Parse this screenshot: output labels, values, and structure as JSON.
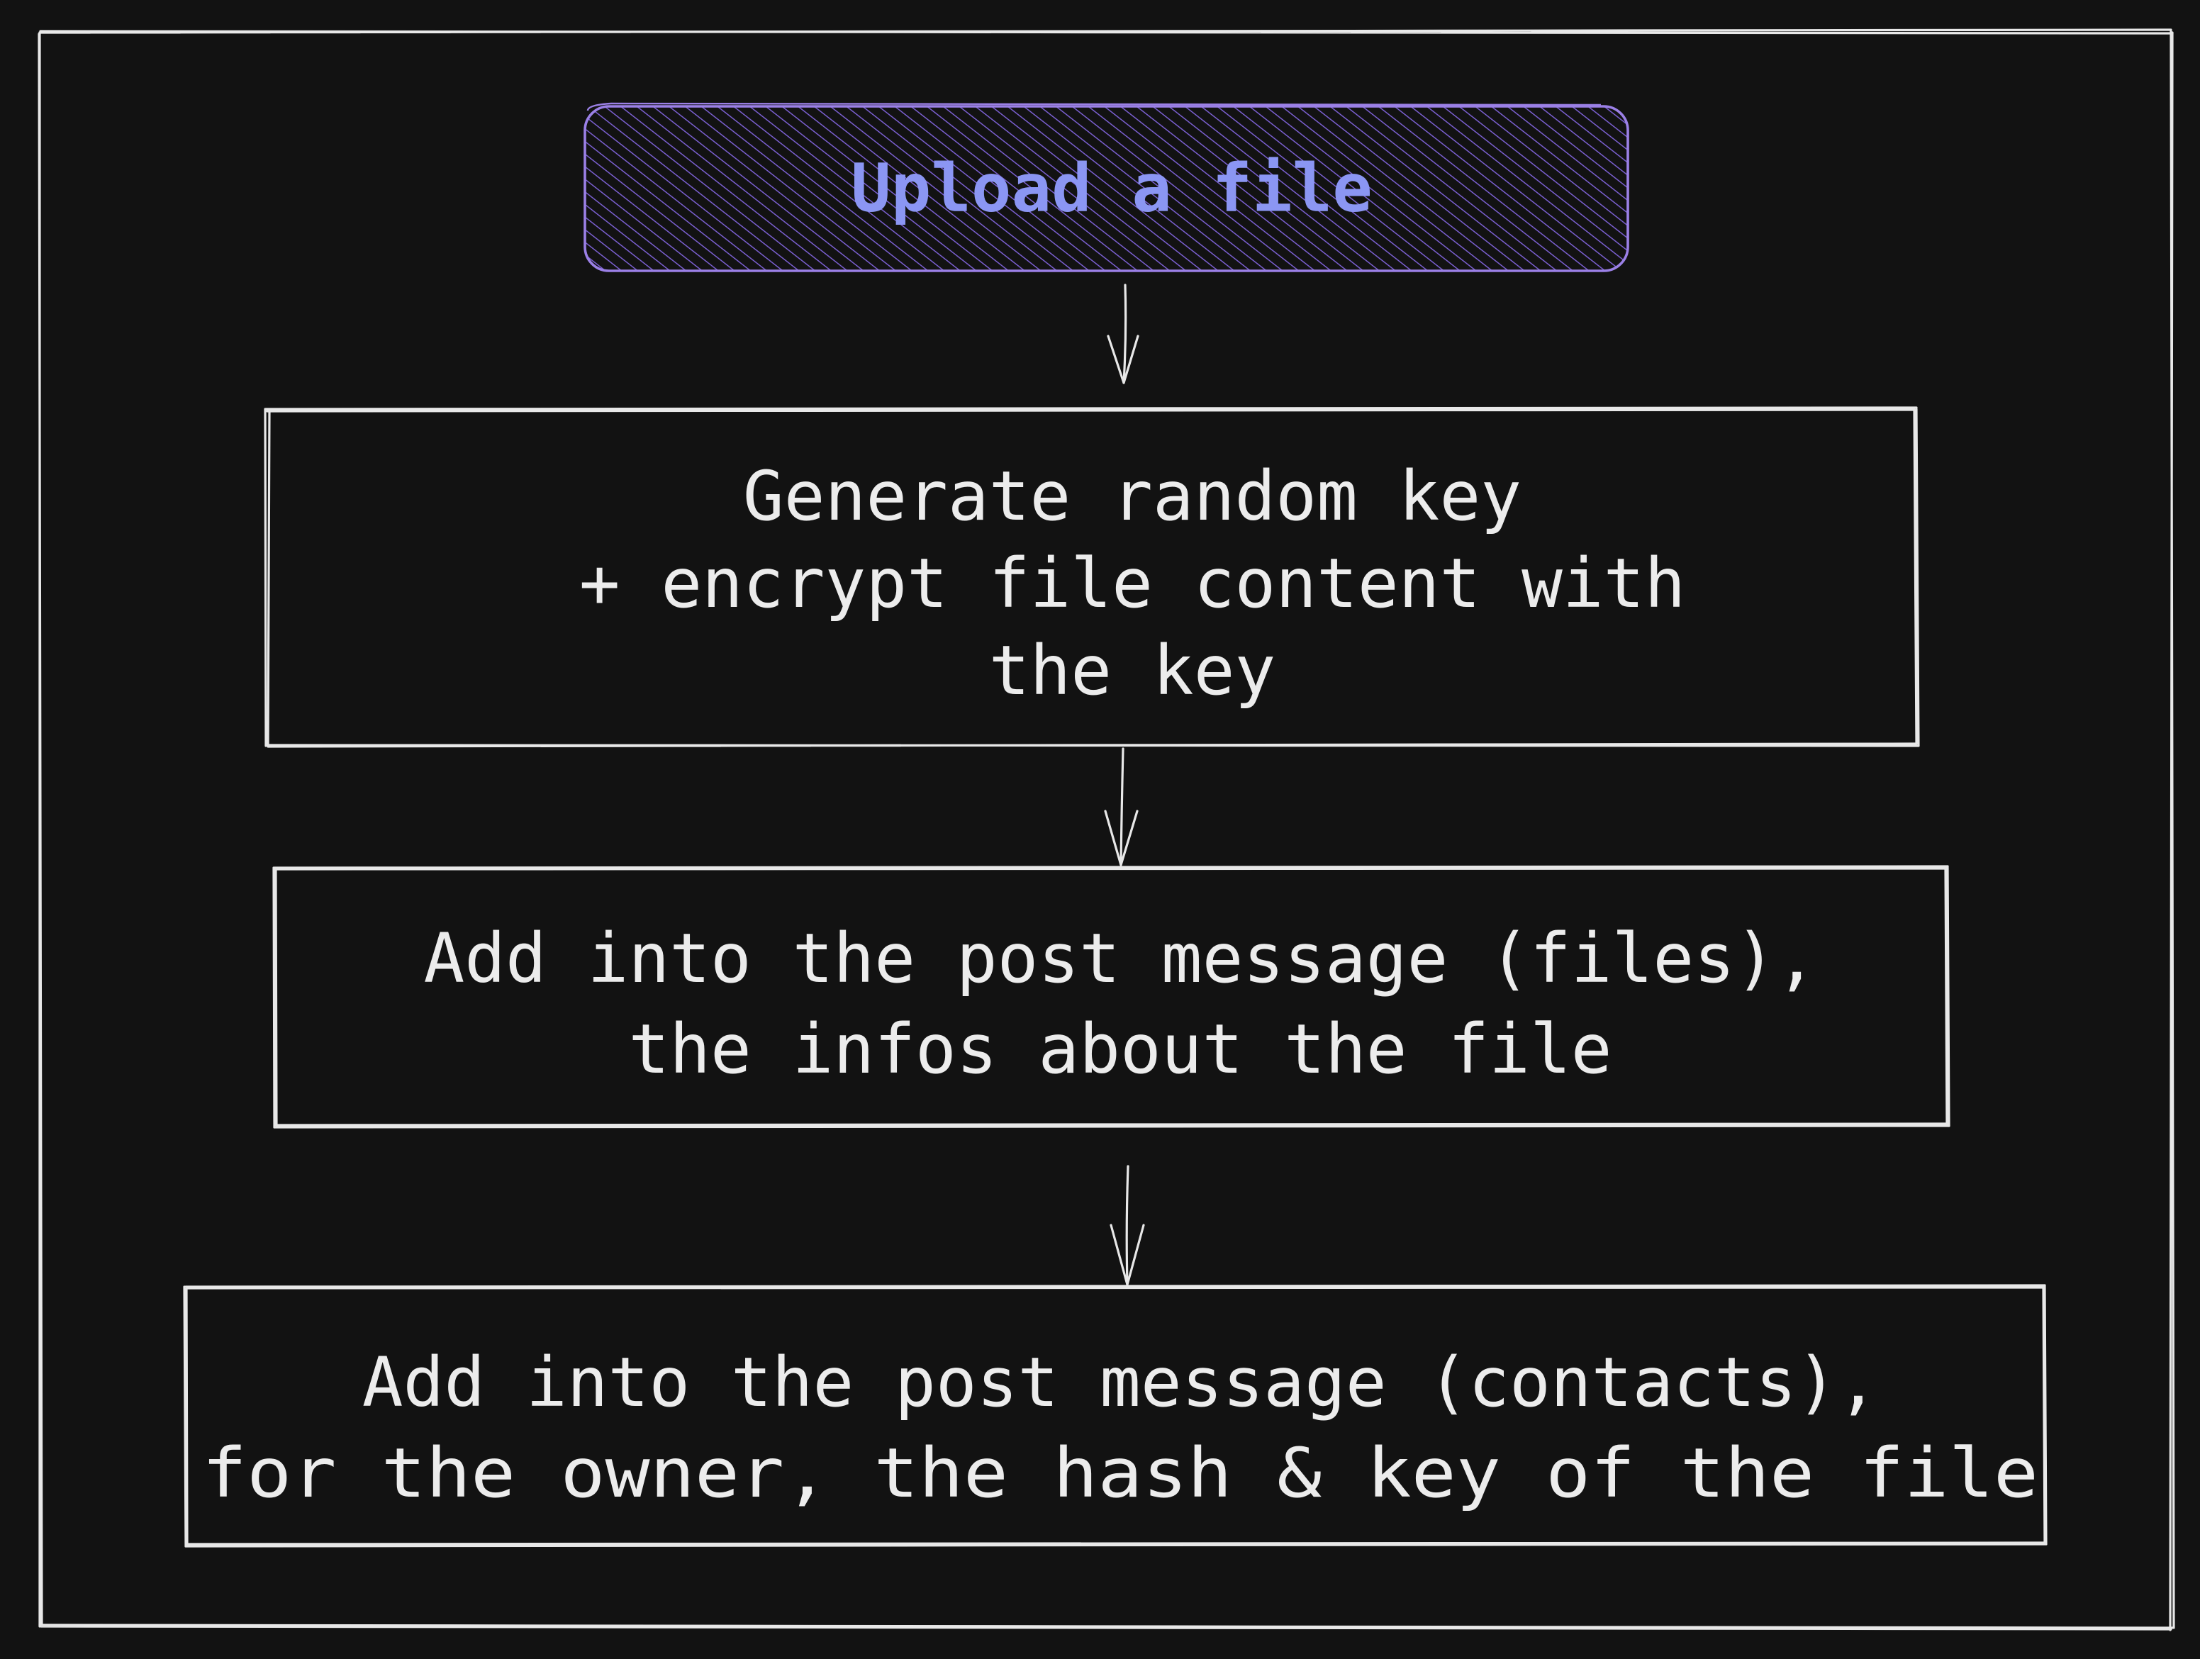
{
  "colors": {
    "background": "#121212",
    "stroke": "#e8e8e8",
    "text": "#ececec",
    "start_stroke": "#9b80e6",
    "start_hatch": "#7a5fd0",
    "start_text": "#8b96f3"
  },
  "nodes": {
    "start": {
      "label": "Upload a file"
    },
    "step1": {
      "lines": [
        "Generate random key",
        "+ encrypt file content with",
        "the key"
      ]
    },
    "step2": {
      "lines": [
        "Add into the post message (files),",
        "the infos about the file"
      ]
    },
    "step3": {
      "lines": [
        "Add into the post message (contacts),",
        "for the owner, the hash & key of the file"
      ]
    }
  }
}
